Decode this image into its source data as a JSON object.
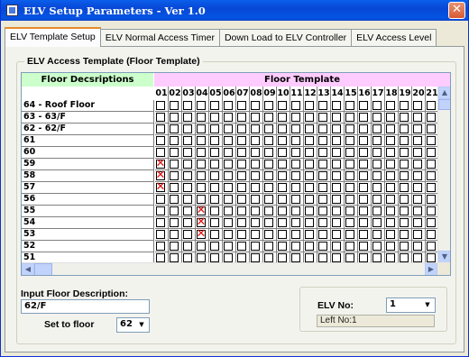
{
  "window": {
    "title": "ELV Setup Parameters - Ver 1.0",
    "close_glyph": "✕"
  },
  "tabs": [
    {
      "label": "ELV Template Setup",
      "active": true
    },
    {
      "label": "ELV Normal Access Timer",
      "active": false
    },
    {
      "label": "Down Load to ELV Controller",
      "active": false
    },
    {
      "label": "ELV Access Level",
      "active": false
    }
  ],
  "template_group": {
    "title": "ELV Access Template (Floor Template)"
  },
  "grid": {
    "left_header": "Floor Decsriptions",
    "right_header": "Floor Template",
    "columns": [
      "01",
      "02",
      "03",
      "04",
      "05",
      "06",
      "07",
      "08",
      "09",
      "10",
      "11",
      "12",
      "13",
      "14",
      "15",
      "16",
      "17",
      "18",
      "19",
      "20",
      "21"
    ],
    "rows": [
      {
        "label": "64 - Roof Floor",
        "checked": []
      },
      {
        "label": "63 - 63/F",
        "checked": []
      },
      {
        "label": "62 - 62/F",
        "checked": []
      },
      {
        "label": "61",
        "checked": []
      },
      {
        "label": "60",
        "checked": []
      },
      {
        "label": "59",
        "checked": [
          0
        ]
      },
      {
        "label": "58",
        "checked": [
          0
        ]
      },
      {
        "label": "57",
        "checked": [
          0
        ]
      },
      {
        "label": "56",
        "checked": []
      },
      {
        "label": "55",
        "checked": [
          3
        ]
      },
      {
        "label": "54",
        "checked": [
          3
        ]
      },
      {
        "label": "53",
        "checked": [
          3
        ]
      },
      {
        "label": "52",
        "checked": []
      },
      {
        "label": "51",
        "checked": []
      }
    ],
    "check_mark": "✕",
    "check_color": "#E01010"
  },
  "input_floor": {
    "label": "Input Floor Description:",
    "value": "62/F",
    "set_to_floor_label": "Set to floor",
    "set_to_floor_value": "62"
  },
  "elv": {
    "label": "ELV No:",
    "value": "1",
    "left_no": "Left No:1"
  },
  "colors": {
    "titlebar": "#0A5FEA",
    "floor_desc_header": "#CCFFCC",
    "floor_template_header": "#FFCCFF"
  }
}
